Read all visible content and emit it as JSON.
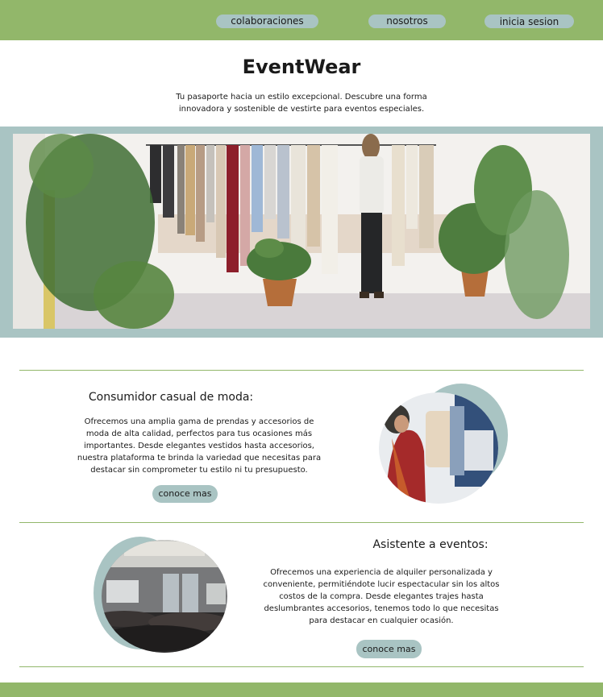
{
  "nav": {
    "items": [
      {
        "label": "colaboraciones"
      },
      {
        "label": "nosotros"
      },
      {
        "label": "inicia sesion"
      }
    ]
  },
  "brand": {
    "title": "EventWear",
    "tagline": "Tu pasaporte hacia un estilo excepcional. Descubre una forma innovadora y sostenible de vestirte para eventos especiales."
  },
  "sections": [
    {
      "title": "Consumidor casual de moda:",
      "body": "Ofrecemos una amplia gama de prendas y accesorios de moda de alta calidad, perfectos para tus ocasiones más importantes. Desde elegantes vestidos hasta accesorios, nuestra plataforma te brinda la variedad que necesitas para destacar sin comprometer tu estilo ni tu presupuesto.",
      "button": "conoce mas"
    },
    {
      "title": "Asistente a eventos:",
      "body": "Ofrecemos una experiencia de alquiler personalizada y conveniente, permitiéndote lucir espectacular sin los altos costos de la compra. Desde elegantes trajes hasta deslumbrantes accesorios, tenemos todo lo que necesitas para destacar en cualquier ocasión.",
      "button": "conoce mas"
    }
  ],
  "colors": {
    "accent_green": "#92b76a",
    "accent_teal": "#a9c4c3"
  }
}
